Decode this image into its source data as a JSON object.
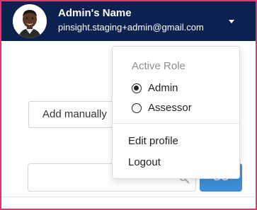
{
  "header": {
    "user_name": "Admin's Name",
    "user_email": "pinsight.staging+admin@gmail.com",
    "background_color": "#0b2150"
  },
  "main": {
    "add_manually_label": "Add manually",
    "search_placeholder": "",
    "go_button_label": "GO",
    "go_button_color": "#3d8fd8"
  },
  "user_menu": {
    "role_heading": "Active Role",
    "roles": [
      {
        "label": "Admin",
        "selected": true
      },
      {
        "label": "Assessor",
        "selected": false
      }
    ],
    "items": [
      {
        "label": "Edit profile"
      },
      {
        "label": "Logout"
      }
    ]
  },
  "frame_border_color": "#e8336d"
}
